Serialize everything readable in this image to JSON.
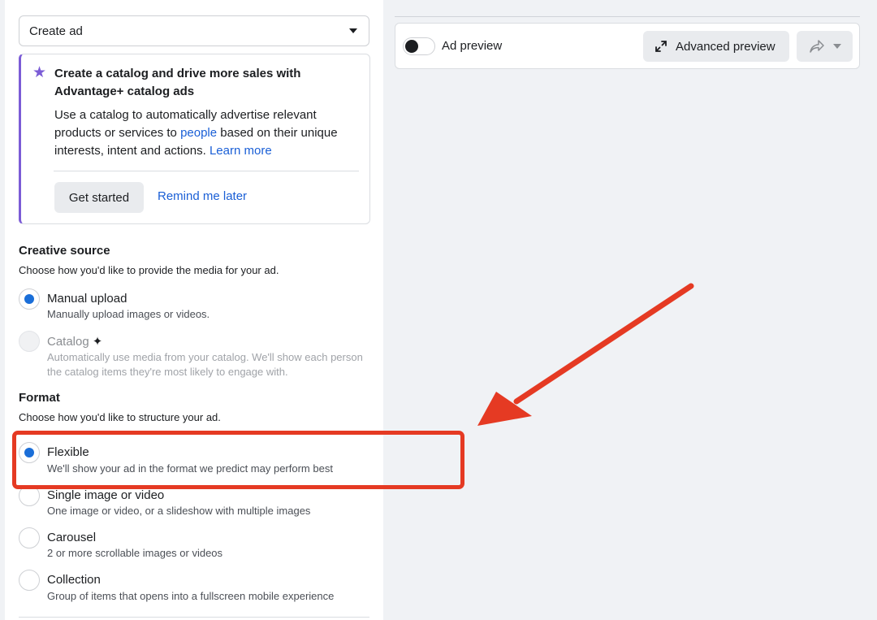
{
  "ad_setup": {
    "dropdown_label": "Create ad"
  },
  "catalog_card": {
    "title": "Create a catalog and drive more sales with Advantage+ catalog ads",
    "body_prefix": "Use a catalog to automatically advertise relevant products or services to ",
    "people_link": "people",
    "body_middle": " based on their unique interests, intent and actions. ",
    "learn_more_link": "Learn more",
    "get_started": "Get started",
    "remind_later": "Remind me later",
    "accent_color": "#7b5cd6"
  },
  "creative_source": {
    "title": "Creative source",
    "description": "Choose how you'd like to provide the media for your ad.",
    "options": [
      {
        "label": "Manual upload",
        "description": "Manually upload images or videos.",
        "selected": true,
        "disabled": false
      },
      {
        "label": "Catalog",
        "description": "Automatically use media from your catalog. We'll show each person the catalog items they're most likely to engage with.",
        "selected": false,
        "disabled": true
      }
    ]
  },
  "format": {
    "title": "Format",
    "description": "Choose how you'd like to structure your ad.",
    "options": [
      {
        "label": "Flexible",
        "description": "We'll show your ad in the format we predict may perform best",
        "selected": true
      },
      {
        "label": "Single image or video",
        "description": "One image or video, or a slideshow with multiple images",
        "selected": false
      },
      {
        "label": "Carousel",
        "description": "2 or more scrollable images or videos",
        "selected": false
      },
      {
        "label": "Collection",
        "description": "Group of items that opens into a fullscreen mobile experience",
        "selected": false
      }
    ]
  },
  "preview": {
    "toggle_label": "Ad preview",
    "toggle_on": false,
    "advanced_preview": "Advanced preview"
  },
  "annotation": {
    "color": "#e53a23"
  }
}
